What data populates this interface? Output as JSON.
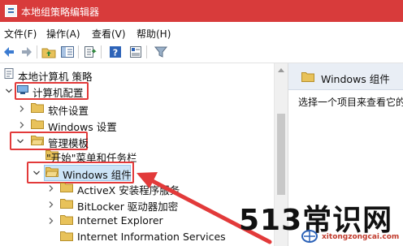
{
  "window": {
    "title": "本地组策略编辑器"
  },
  "menu": [
    {
      "label": "文件(F)"
    },
    {
      "label": "操作(A)"
    },
    {
      "label": "查看(V)"
    },
    {
      "label": "帮助(H)"
    }
  ],
  "toolbar": {
    "icons": [
      "back-arrow-icon",
      "forward-arrow-icon",
      "up-folder-icon",
      "show-hide-tree-icon",
      "export-list-icon",
      "help-icon",
      "properties-icon",
      "filter-icon"
    ]
  },
  "tree": {
    "root": "本地计算机 策略",
    "computer_config": "计算机配置",
    "software_settings": "软件设置",
    "windows_settings": "Windows 设置",
    "admin_templates": "管理模板",
    "start_menu": "\"开始\"菜单和任务栏",
    "windows_components": "Windows 组件",
    "activex": "ActiveX 安装程序服务",
    "bitlocker": "BitLocker 驱动器加密",
    "ie": "Internet Explorer",
    "iis": "Internet Information Services"
  },
  "right_pane": {
    "header": "Windows 组件",
    "description": "选择一个项目来查看它的"
  },
  "watermark": {
    "title": "513常识网",
    "url": "xitongzongcai.com"
  },
  "colors": {
    "titlebar": "#d83b3b",
    "highlight": "#e23a3a",
    "selection": "#cce4f7",
    "folder": "#e8c25a"
  }
}
